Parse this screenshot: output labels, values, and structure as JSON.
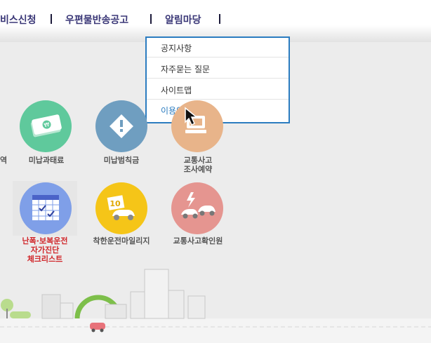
{
  "nav": {
    "items": [
      {
        "label": "비스신청"
      },
      {
        "label": "우편물반송공고"
      },
      {
        "label": "알림마당"
      }
    ]
  },
  "dropdown": {
    "items": [
      {
        "label": "공지사항"
      },
      {
        "label": "자주묻는 질문"
      },
      {
        "label": "사이트맵"
      },
      {
        "label": "이용안내"
      }
    ],
    "active_index": 3
  },
  "services": {
    "row1": [
      {
        "label": "역",
        "icon": "partial-icon"
      },
      {
        "label": "미납과태료",
        "icon": "money-icon",
        "color": "#5fc99c"
      },
      {
        "label": "미납범칙금",
        "icon": "warning-diamond-icon",
        "color": "#6f9ec0"
      },
      {
        "label_line1": "교통사고",
        "label_line2": "조사예약",
        "icon": "computer-icon",
        "color": "#e8b48a"
      }
    ],
    "row2": [
      {
        "label_line1": "난폭·보복운전",
        "label_line2": "자가진단",
        "label_line3": "체크리스트",
        "icon": "calendar-check-icon",
        "color": "#7f9fe8"
      },
      {
        "label": "착한운전마일리지",
        "icon": "mileage-car-icon",
        "color": "#f5c518"
      },
      {
        "label": "교통사고확인원",
        "icon": "car-crash-icon",
        "color": "#e59590"
      }
    ]
  },
  "colors": {
    "nav_text": "#3a3777",
    "dropdown_border": "#2b7cc0",
    "active_link": "#2b7cc0",
    "alert_text": "#d0262a"
  }
}
